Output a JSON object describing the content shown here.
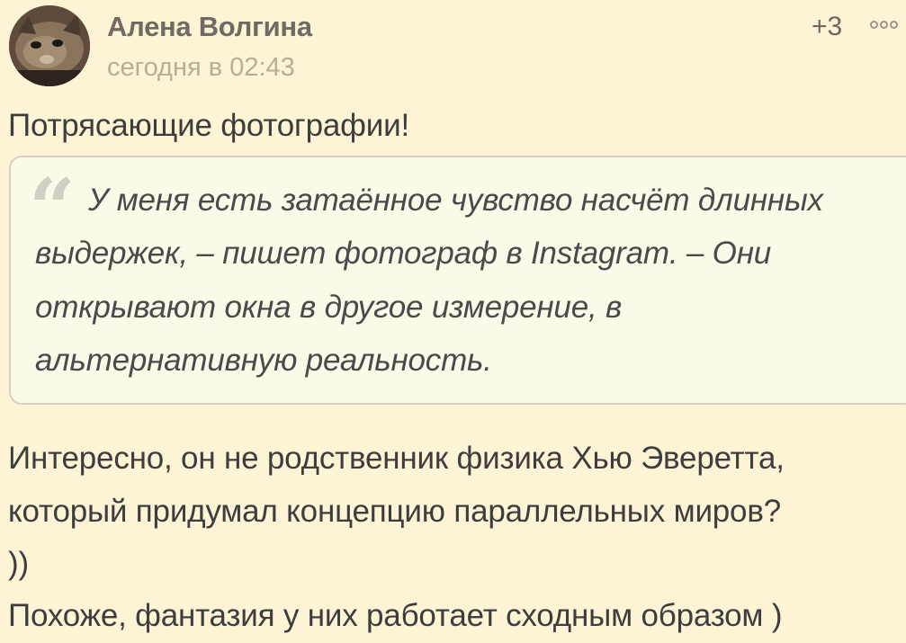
{
  "comment": {
    "author": "Алена Волгина",
    "time": "сегодня в 02:43",
    "rating": "+3",
    "lead": "Потрясающие фотографии!",
    "quote_lines": [
      "У меня есть затаённое чувство насчёт длинных",
      "выдержек, – пишет фотограф в Instagram. – Они",
      "открывают окна в другое измерение, в",
      "альтернативную реальность."
    ],
    "body_lines": [
      "Интересно, он не родственник физика Хью Эверетта,",
      "который придумал концепцию параллельных миров?",
      "))",
      "Похоже, фантазия у них работает сходным образом )"
    ],
    "quote_glyph": "“",
    "icons": {
      "avatar": "cat-avatar",
      "more": "more-dots-icon",
      "quote": "quote-icon"
    }
  }
}
